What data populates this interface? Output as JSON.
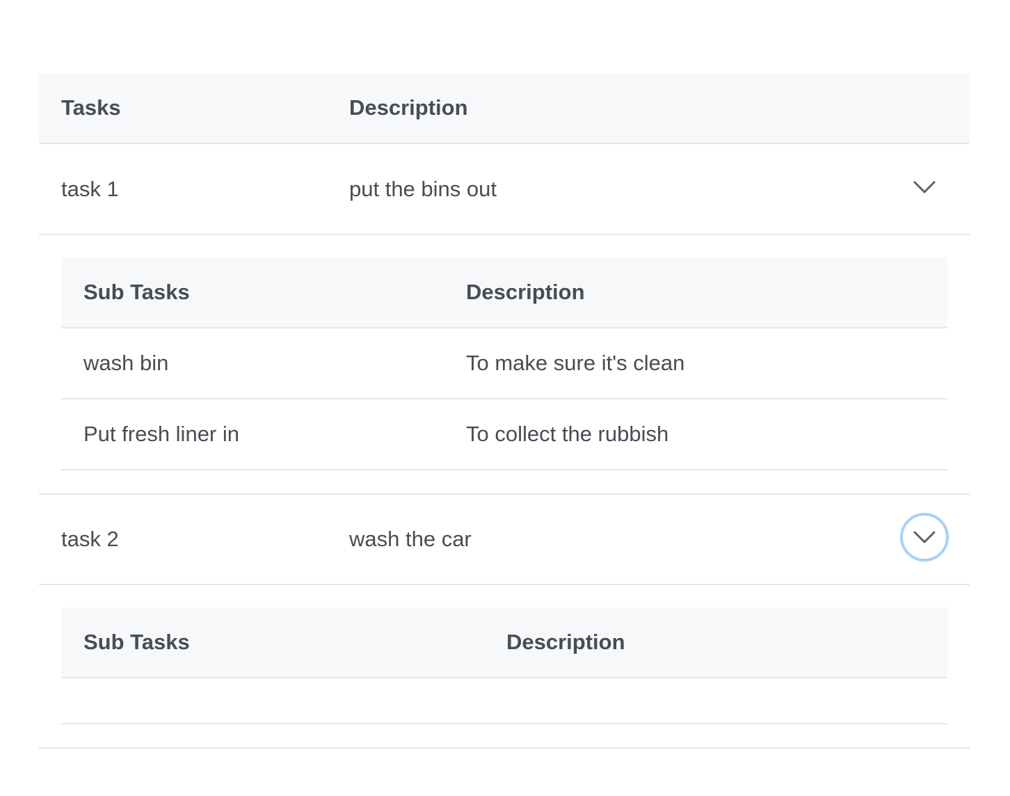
{
  "table": {
    "headers": {
      "tasks": "Tasks",
      "description": "Description"
    },
    "tasks": [
      {
        "name": "task 1",
        "description": "put the bins out",
        "toggle_icon": "chevron-down-icon",
        "subtable": {
          "headers": {
            "subtasks": "Sub Tasks",
            "description": "Description"
          },
          "rows": [
            {
              "name": "wash bin",
              "description": "To make sure it's clean"
            },
            {
              "name": "Put fresh liner in",
              "description": "To collect the rubbish"
            }
          ]
        }
      },
      {
        "name": "task 2",
        "description": "wash the car",
        "toggle_icon": "chevron-down-icon",
        "toggle_state": "focused",
        "subtable": {
          "headers": {
            "subtasks": "Sub Tasks",
            "description": "Description"
          },
          "rows": []
        }
      }
    ]
  },
  "colors": {
    "header_bg": "#f7f8f9",
    "border": "#e4e6e8",
    "text": "#474d55",
    "focus_ring": "#a9d0f5"
  }
}
